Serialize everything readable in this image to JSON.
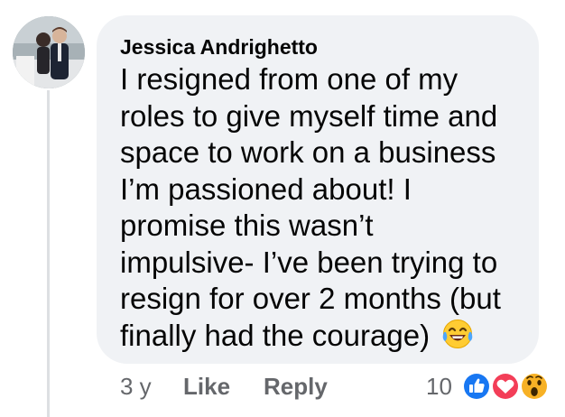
{
  "comment": {
    "author": "Jessica Andrighetto",
    "text_lines": [
      "I resigned from one of my",
      "roles to give myself time and",
      "space to work on a business",
      "I’m passioned about! I",
      "promise this wasn’t",
      "impulsive- I’ve been trying to",
      "resign for over 2 months (but",
      "finally had the courage)"
    ],
    "trailing_emoji": "laughing-with-tears-emoji"
  },
  "actions": {
    "timestamp": "3 y",
    "like_label": "Like",
    "reply_label": "Reply"
  },
  "reactions": {
    "count": "10",
    "types": [
      "like",
      "love",
      "wow"
    ]
  },
  "colors": {
    "bubble": "#f0f2f5",
    "text": "#050505",
    "secondary_text": "#65676b",
    "like_blue": "#1877f2",
    "love_red": "#f33e58",
    "wow_yellow": "#f7b125"
  }
}
